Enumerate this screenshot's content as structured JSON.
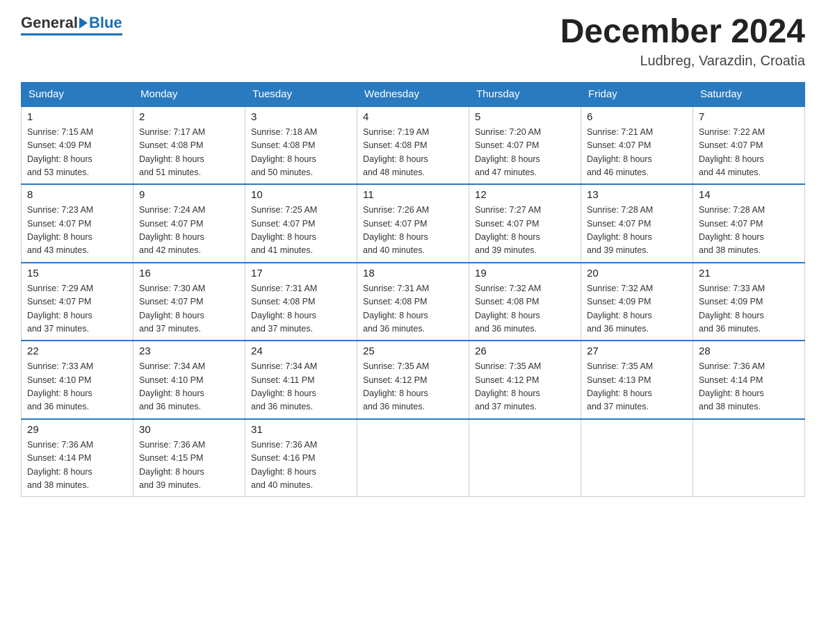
{
  "logo": {
    "general": "General",
    "blue": "Blue"
  },
  "header": {
    "month_title": "December 2024",
    "location": "Ludbreg, Varazdin, Croatia"
  },
  "weekdays": [
    "Sunday",
    "Monday",
    "Tuesday",
    "Wednesday",
    "Thursday",
    "Friday",
    "Saturday"
  ],
  "weeks": [
    [
      {
        "day": "1",
        "sunrise": "7:15 AM",
        "sunset": "4:09 PM",
        "daylight": "8 hours and 53 minutes."
      },
      {
        "day": "2",
        "sunrise": "7:17 AM",
        "sunset": "4:08 PM",
        "daylight": "8 hours and 51 minutes."
      },
      {
        "day": "3",
        "sunrise": "7:18 AM",
        "sunset": "4:08 PM",
        "daylight": "8 hours and 50 minutes."
      },
      {
        "day": "4",
        "sunrise": "7:19 AM",
        "sunset": "4:08 PM",
        "daylight": "8 hours and 48 minutes."
      },
      {
        "day": "5",
        "sunrise": "7:20 AM",
        "sunset": "4:07 PM",
        "daylight": "8 hours and 47 minutes."
      },
      {
        "day": "6",
        "sunrise": "7:21 AM",
        "sunset": "4:07 PM",
        "daylight": "8 hours and 46 minutes."
      },
      {
        "day": "7",
        "sunrise": "7:22 AM",
        "sunset": "4:07 PM",
        "daylight": "8 hours and 44 minutes."
      }
    ],
    [
      {
        "day": "8",
        "sunrise": "7:23 AM",
        "sunset": "4:07 PM",
        "daylight": "8 hours and 43 minutes."
      },
      {
        "day": "9",
        "sunrise": "7:24 AM",
        "sunset": "4:07 PM",
        "daylight": "8 hours and 42 minutes."
      },
      {
        "day": "10",
        "sunrise": "7:25 AM",
        "sunset": "4:07 PM",
        "daylight": "8 hours and 41 minutes."
      },
      {
        "day": "11",
        "sunrise": "7:26 AM",
        "sunset": "4:07 PM",
        "daylight": "8 hours and 40 minutes."
      },
      {
        "day": "12",
        "sunrise": "7:27 AM",
        "sunset": "4:07 PM",
        "daylight": "8 hours and 39 minutes."
      },
      {
        "day": "13",
        "sunrise": "7:28 AM",
        "sunset": "4:07 PM",
        "daylight": "8 hours and 39 minutes."
      },
      {
        "day": "14",
        "sunrise": "7:28 AM",
        "sunset": "4:07 PM",
        "daylight": "8 hours and 38 minutes."
      }
    ],
    [
      {
        "day": "15",
        "sunrise": "7:29 AM",
        "sunset": "4:07 PM",
        "daylight": "8 hours and 37 minutes."
      },
      {
        "day": "16",
        "sunrise": "7:30 AM",
        "sunset": "4:07 PM",
        "daylight": "8 hours and 37 minutes."
      },
      {
        "day": "17",
        "sunrise": "7:31 AM",
        "sunset": "4:08 PM",
        "daylight": "8 hours and 37 minutes."
      },
      {
        "day": "18",
        "sunrise": "7:31 AM",
        "sunset": "4:08 PM",
        "daylight": "8 hours and 36 minutes."
      },
      {
        "day": "19",
        "sunrise": "7:32 AM",
        "sunset": "4:08 PM",
        "daylight": "8 hours and 36 minutes."
      },
      {
        "day": "20",
        "sunrise": "7:32 AM",
        "sunset": "4:09 PM",
        "daylight": "8 hours and 36 minutes."
      },
      {
        "day": "21",
        "sunrise": "7:33 AM",
        "sunset": "4:09 PM",
        "daylight": "8 hours and 36 minutes."
      }
    ],
    [
      {
        "day": "22",
        "sunrise": "7:33 AM",
        "sunset": "4:10 PM",
        "daylight": "8 hours and 36 minutes."
      },
      {
        "day": "23",
        "sunrise": "7:34 AM",
        "sunset": "4:10 PM",
        "daylight": "8 hours and 36 minutes."
      },
      {
        "day": "24",
        "sunrise": "7:34 AM",
        "sunset": "4:11 PM",
        "daylight": "8 hours and 36 minutes."
      },
      {
        "day": "25",
        "sunrise": "7:35 AM",
        "sunset": "4:12 PM",
        "daylight": "8 hours and 36 minutes."
      },
      {
        "day": "26",
        "sunrise": "7:35 AM",
        "sunset": "4:12 PM",
        "daylight": "8 hours and 37 minutes."
      },
      {
        "day": "27",
        "sunrise": "7:35 AM",
        "sunset": "4:13 PM",
        "daylight": "8 hours and 37 minutes."
      },
      {
        "day": "28",
        "sunrise": "7:36 AM",
        "sunset": "4:14 PM",
        "daylight": "8 hours and 38 minutes."
      }
    ],
    [
      {
        "day": "29",
        "sunrise": "7:36 AM",
        "sunset": "4:14 PM",
        "daylight": "8 hours and 38 minutes."
      },
      {
        "day": "30",
        "sunrise": "7:36 AM",
        "sunset": "4:15 PM",
        "daylight": "8 hours and 39 minutes."
      },
      {
        "day": "31",
        "sunrise": "7:36 AM",
        "sunset": "4:16 PM",
        "daylight": "8 hours and 40 minutes."
      },
      null,
      null,
      null,
      null
    ]
  ],
  "labels": {
    "sunrise": "Sunrise:",
    "sunset": "Sunset:",
    "daylight": "Daylight:"
  }
}
